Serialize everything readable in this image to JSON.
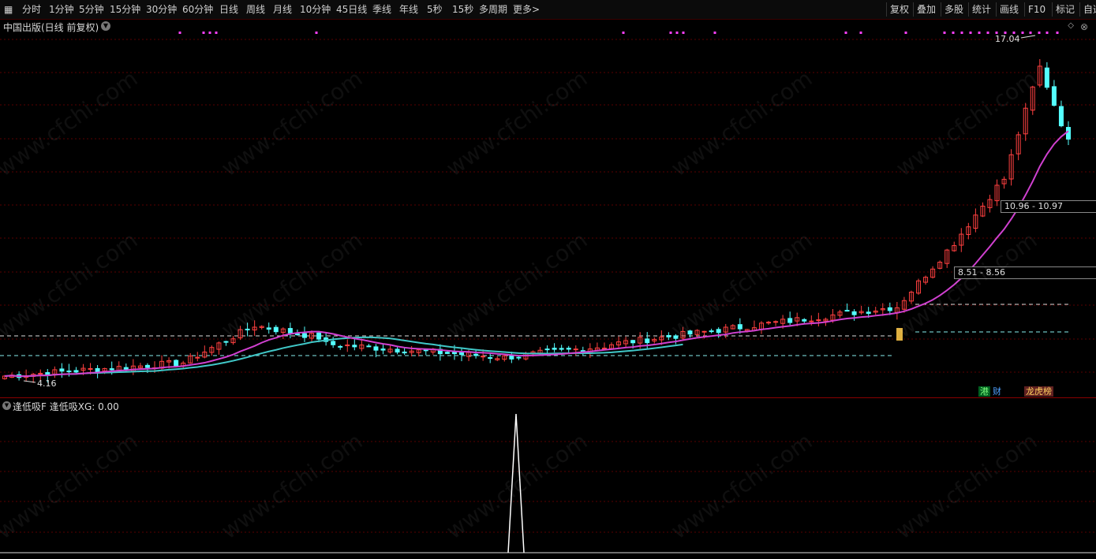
{
  "toolbar": {
    "periods": [
      "分时",
      "1分钟",
      "5分钟",
      "15分钟",
      "30分钟",
      "60分钟",
      "日线",
      "周线",
      "月线",
      "10分钟",
      "45日线",
      "季线",
      "年线",
      "5秒",
      "15秒",
      "多周期",
      "更多>"
    ],
    "tools": [
      "复权",
      "叠加",
      "多股",
      "统计",
      "画线",
      "F10",
      "标记",
      "自选"
    ]
  },
  "chart": {
    "title": "中国出版(日线 前复权)",
    "high_label": "17.04",
    "low_label": "4.16",
    "range_label_1": "10.96 - 10.97",
    "range_label_2": "8.51 - 8.56",
    "badge_hk": "港",
    "badge_fin": "财",
    "badge_rank": "龙虎榜",
    "watermark": "www.cfchi.com"
  },
  "indicator": {
    "label": "逢低吸F  逢低吸XG: 0.00"
  },
  "colors": {
    "up": "#ff4040",
    "down": "#54ffff",
    "ma": "#d040d0",
    "ma_cyan": "#40c8c8",
    "grid": "#5a0000",
    "marker": "#ff40ff"
  }
}
